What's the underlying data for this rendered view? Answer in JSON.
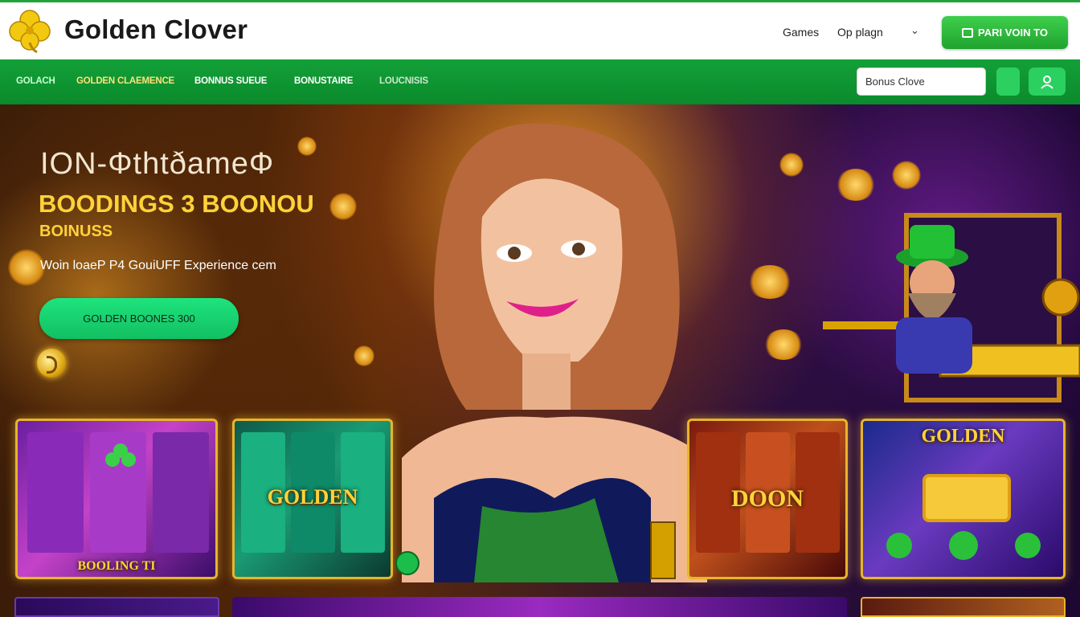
{
  "header": {
    "brand": "Golden Clover",
    "nav_links": [
      "Games",
      "Op plagn"
    ],
    "cta_label": "PARI VOIN TO"
  },
  "menu": {
    "items": [
      "GOLACH",
      "GOLDEN CLAEMENCE",
      "BONNUS SUEUE",
      "BONUSTAIRE",
      "LOUCNISIS"
    ]
  },
  "search": {
    "value": "Bonus Clove"
  },
  "hero": {
    "headline": "ION-ΦthtðameΦ",
    "subheadline": "BOODINGS 3 BOONOU",
    "tagline": "BOINUSS",
    "description": "Woin loaeP P4 GouiUFF Experience cem",
    "button_label": "GOLDEN BOONES 300"
  },
  "tiles": [
    {
      "label": "BOOLING TI"
    },
    {
      "label": "GOLDEN"
    },
    {
      "label": "DOON"
    },
    {
      "label": "GOLDEN"
    }
  ],
  "colors": {
    "brand_green": "#13a038",
    "accent_gold": "#ffd23a",
    "button_green": "#1ee47d"
  }
}
